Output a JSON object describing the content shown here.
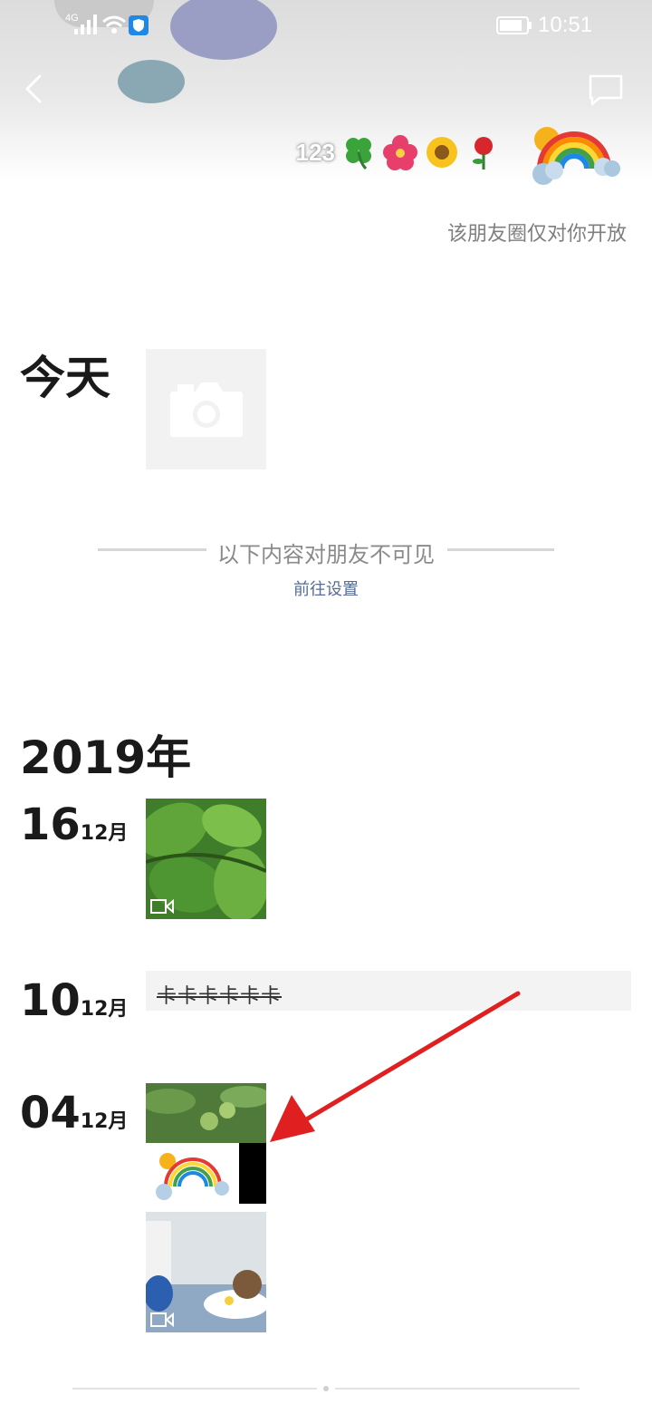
{
  "status_bar": {
    "network": "4G",
    "time": "10:51"
  },
  "profile": {
    "nickname_text": "123",
    "nickname_emojis": [
      "clover-emoji",
      "hibiscus-emoji",
      "sunflower-emoji",
      "rose-emoji"
    ],
    "avatar": "rainbow-cloud-image",
    "visibility_note": "该朋友圈仅对你开放"
  },
  "today": {
    "label": "今天",
    "camera_icon": "camera-icon"
  },
  "hidden_divider": {
    "text": "以下内容对朋友不可见",
    "link": "前往设置"
  },
  "year": "2019年",
  "posts": [
    {
      "day": "16",
      "month": "12月",
      "type": "video",
      "image": "green-leaves-photo"
    },
    {
      "day": "10",
      "month": "12月",
      "type": "text",
      "text": "卡卡卡卡卡卡"
    },
    {
      "day": "04",
      "month": "12月",
      "type": "images",
      "images": [
        "persimmon-tree-photo",
        "rainbow-sticker-image",
        "cup-and-doll-photo"
      ],
      "video": true
    }
  ],
  "annotation": {
    "arrow_color": "#e02020"
  },
  "colors": {
    "link": "#576b95",
    "note": "#7f7f7f"
  }
}
